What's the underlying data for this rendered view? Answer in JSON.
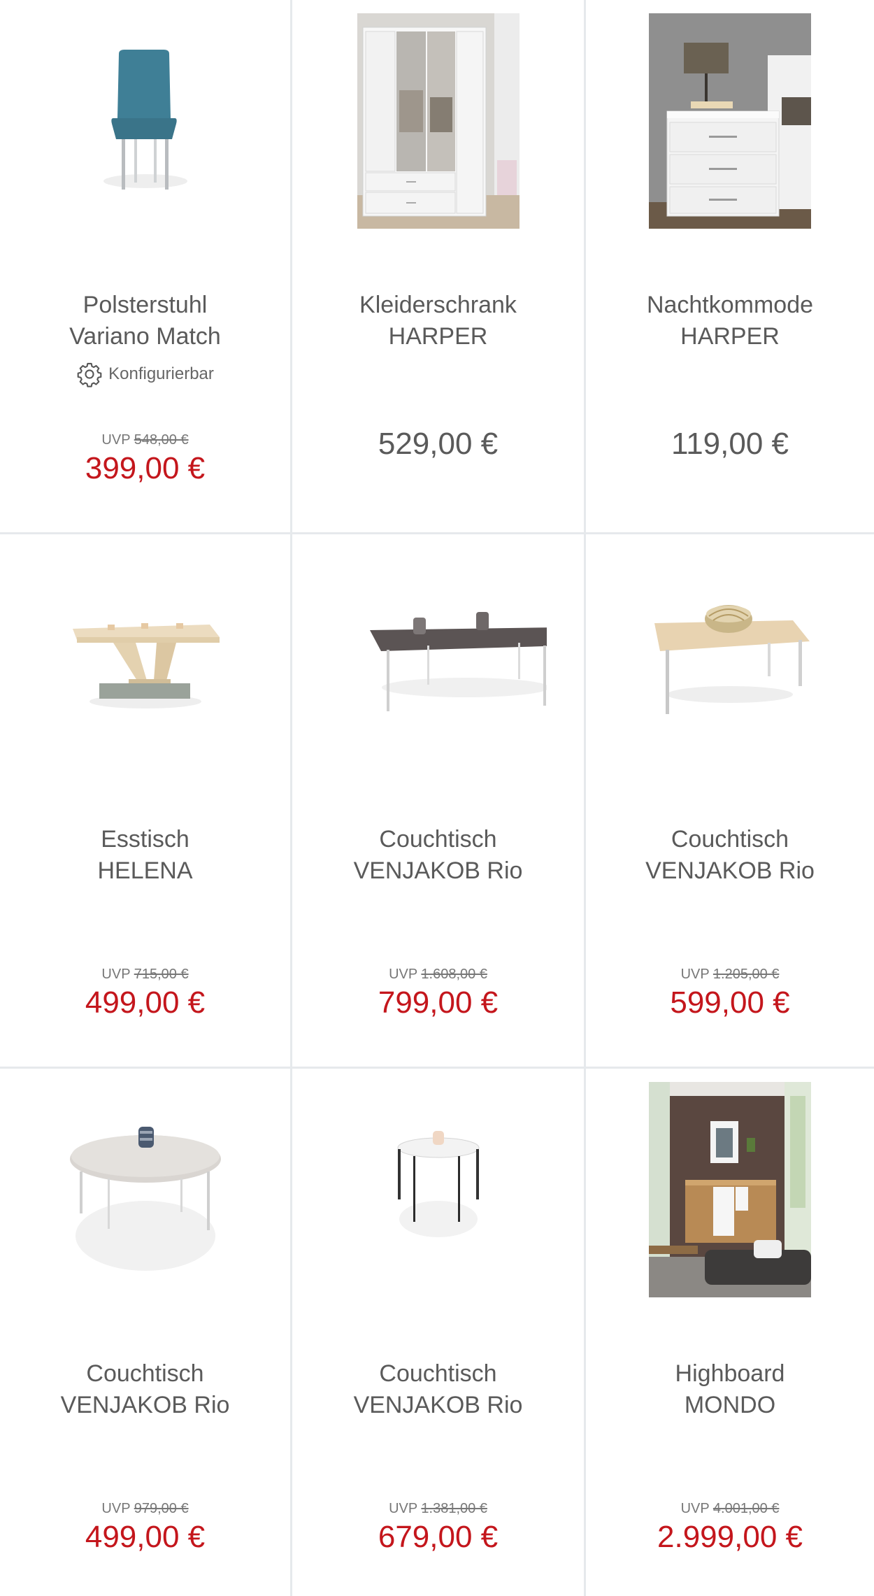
{
  "config_label": "Konfigurierbar",
  "uvp_label": "UVP",
  "products": [
    {
      "title": "Polsterstuhl\nVariano Match",
      "image_icon": "upholstered-chair",
      "configurable": true,
      "uvp": "548,00 €",
      "price": "399,00 €",
      "on_sale": true
    },
    {
      "title": "Kleiderschrank\nHARPER",
      "image_icon": "wardrobe",
      "configurable": false,
      "uvp": null,
      "price": "529,00 €",
      "on_sale": false
    },
    {
      "title": "Nachtkommode\nHARPER",
      "image_icon": "nightstand",
      "configurable": false,
      "uvp": null,
      "price": "119,00 €",
      "on_sale": false
    },
    {
      "title": "Esstisch\nHELENA",
      "image_icon": "dining-table",
      "configurable": false,
      "uvp": "715,00 €",
      "price": "499,00 €",
      "on_sale": true
    },
    {
      "title": "Couchtisch\nVENJAKOB Rio",
      "image_icon": "coffee-table-dark",
      "configurable": false,
      "uvp": "1.608,00 €",
      "price": "799,00 €",
      "on_sale": true
    },
    {
      "title": "Couchtisch\nVENJAKOB Rio",
      "image_icon": "coffee-table-oak",
      "configurable": false,
      "uvp": "1.205,00 €",
      "price": "599,00 €",
      "on_sale": true
    },
    {
      "title": "Couchtisch\nVENJAKOB Rio",
      "image_icon": "coffee-table-round",
      "configurable": false,
      "uvp": "979,00 €",
      "price": "499,00 €",
      "on_sale": true
    },
    {
      "title": "Couchtisch\nVENJAKOB Rio",
      "image_icon": "side-table-round",
      "configurable": false,
      "uvp": "1.381,00 €",
      "price": "679,00 €",
      "on_sale": true
    },
    {
      "title": "Highboard\nMONDO",
      "image_icon": "highboard",
      "configurable": false,
      "uvp": "4.001,00 €",
      "price": "2.999,00 €",
      "on_sale": true
    }
  ],
  "colors": {
    "sale_red": "#c4161c",
    "text_gray": "#5a5a5a",
    "divider": "#e6e9ec"
  }
}
